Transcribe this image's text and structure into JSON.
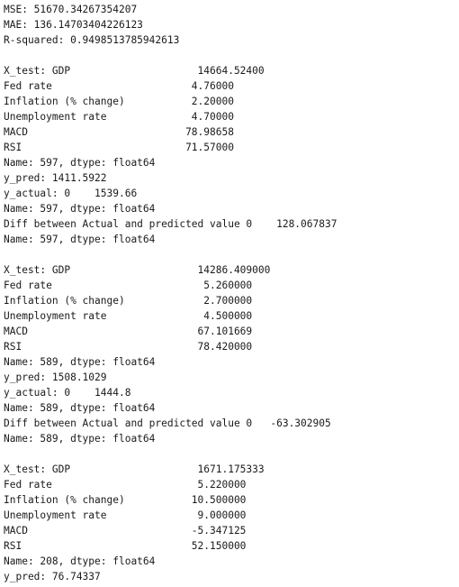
{
  "output": {
    "lines": [
      "MSE: 51670.34267354207",
      "MAE: 136.14703404226123",
      "R-squared: 0.9498513785942613",
      "",
      "X_test: GDP                     14664.52400",
      "Fed rate                       4.76000",
      "Inflation (% change)           2.20000",
      "Unemployment rate              4.70000",
      "MACD                          78.98658",
      "RSI                           71.57000",
      "Name: 597, dtype: float64",
      "y_pred: 1411.5922",
      "y_actual: 0    1539.66",
      "Name: 597, dtype: float64",
      "Diff between Actual and predicted value 0    128.067837",
      "Name: 597, dtype: float64",
      "",
      "X_test: GDP                     14286.409000",
      "Fed rate                         5.260000",
      "Inflation (% change)             2.700000",
      "Unemployment rate                4.500000",
      "MACD                            67.101669",
      "RSI                             78.420000",
      "Name: 589, dtype: float64",
      "y_pred: 1508.1029",
      "y_actual: 0    1444.8",
      "Name: 589, dtype: float64",
      "Diff between Actual and predicted value 0   -63.302905",
      "Name: 589, dtype: float64",
      "",
      "X_test: GDP                     1671.175333",
      "Fed rate                        5.220000",
      "Inflation (% change)           10.500000",
      "Unemployment rate               9.000000",
      "MACD                           -5.347125",
      "RSI                            52.150000",
      "Name: 208, dtype: float64",
      "y_pred: 76.74337"
    ]
  }
}
